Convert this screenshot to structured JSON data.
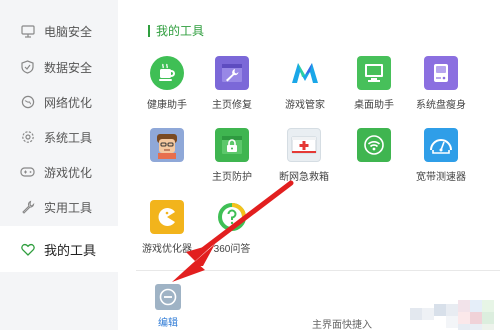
{
  "sidebar": {
    "items": [
      {
        "label": "电脑安全",
        "icon": "monitor-icon"
      },
      {
        "label": "数据安全",
        "icon": "shield-icon"
      },
      {
        "label": "网络优化",
        "icon": "globe-icon"
      },
      {
        "label": "系统工具",
        "icon": "gear-icon"
      },
      {
        "label": "游戏优化",
        "icon": "gamepad-icon"
      },
      {
        "label": "实用工具",
        "icon": "wrench-icon"
      },
      {
        "label": "我的工具",
        "icon": "heart-icon",
        "active": true
      }
    ]
  },
  "main": {
    "section_title": "我的工具",
    "tools": [
      {
        "name": "健康助手",
        "icon": "tea-cup-icon",
        "color": "#3fbf55"
      },
      {
        "name": "主页修复",
        "icon": "wrench-icon",
        "color": "#7b68d8"
      },
      {
        "name": "游戏管家",
        "icon": "game-logo-icon",
        "color": "#1aa7e8"
      },
      {
        "name": "桌面助手",
        "icon": "desktop-icon",
        "color": "#47c05a"
      },
      {
        "name": "系统盘瘦身",
        "icon": "disk-icon",
        "color": "#8b6fe0"
      },
      {
        "name": "",
        "icon": "avatar-icon",
        "color": "#8fa8d8"
      },
      {
        "name": "主页防护",
        "icon": "lock-icon",
        "color": "#3fb550"
      },
      {
        "name": "断网急救箱",
        "icon": "first-aid-icon",
        "color": "#e9eef2"
      },
      {
        "name": "",
        "icon": "wifi-icon",
        "color": "#3fb550"
      },
      {
        "name": "宽带测速器",
        "icon": "speedometer-icon",
        "color": "#2f9ee8"
      },
      {
        "name": "游戏优化器",
        "icon": "pacman-icon",
        "color": "#f2b41c"
      },
      {
        "name": "360问答",
        "icon": "question-icon",
        "color": "#ffffff"
      }
    ],
    "edit_label": "编辑",
    "footer_text": "主界面快捷入"
  },
  "colors": {
    "accent": "#2f9e3e",
    "arrow": "#e21f1f",
    "sidebar_bg": "#f4f5f7"
  }
}
